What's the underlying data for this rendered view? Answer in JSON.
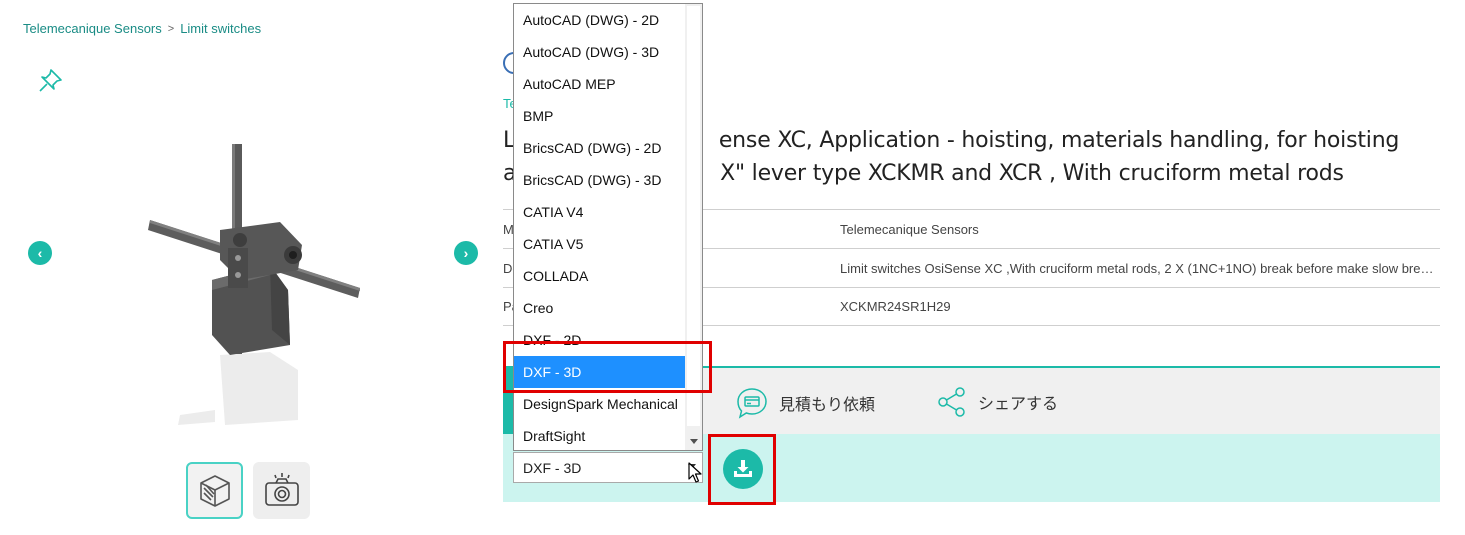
{
  "breadcrumb": {
    "items": [
      "Telemecanique Sensors",
      "Limit switches"
    ],
    "separator": ">"
  },
  "icons": {
    "pin": "pin-icon",
    "prev": "chevron-left-icon",
    "next": "chevron-right-icon",
    "model3d": "cube-3d-icon",
    "camera": "camera-icon",
    "quote": "quote-card-icon",
    "share": "share-icon",
    "download": "download-icon"
  },
  "nav": {
    "prev": "‹",
    "next": "›"
  },
  "product": {
    "brand_fragment": "Te",
    "title_line1": "L                              ense XC, Application - hoisting, materials handling, for hoisting",
    "title_line2": "a                              X\" lever type XCKMR and XCR , With cruciform metal rods"
  },
  "specs": [
    {
      "key": "M",
      "value": "Telemecanique Sensors"
    },
    {
      "key": "De",
      "value": "Limit switches OsiSense XC ,With cruciform metal rods, 2 X (1NC+1NO) break before make slow break..."
    },
    {
      "key": "Pa",
      "value": "XCKMR24SR1H29"
    }
  ],
  "actions": {
    "quote_label": "見積もり依頼",
    "share_label": "シェアする"
  },
  "format_select": {
    "selected": "DXF - 3D",
    "options": [
      "AutoCAD (DWG) - 2D",
      "AutoCAD (DWG) - 3D",
      "AutoCAD MEP",
      "BMP",
      "BricsCAD (DWG) - 2D",
      "BricsCAD (DWG) - 3D",
      "CATIA V4",
      "CATIA V5",
      "COLLADA",
      "Creo",
      "DXF - 2D",
      "DXF - 3D",
      "DesignSpark Mechanical",
      "DraftSight"
    ],
    "highlighted_index": 11
  },
  "colors": {
    "teal": "#1cbaa8",
    "teal_light": "#ccf4ef",
    "highlight_red": "#e00000",
    "selected_blue": "#1e90ff"
  }
}
